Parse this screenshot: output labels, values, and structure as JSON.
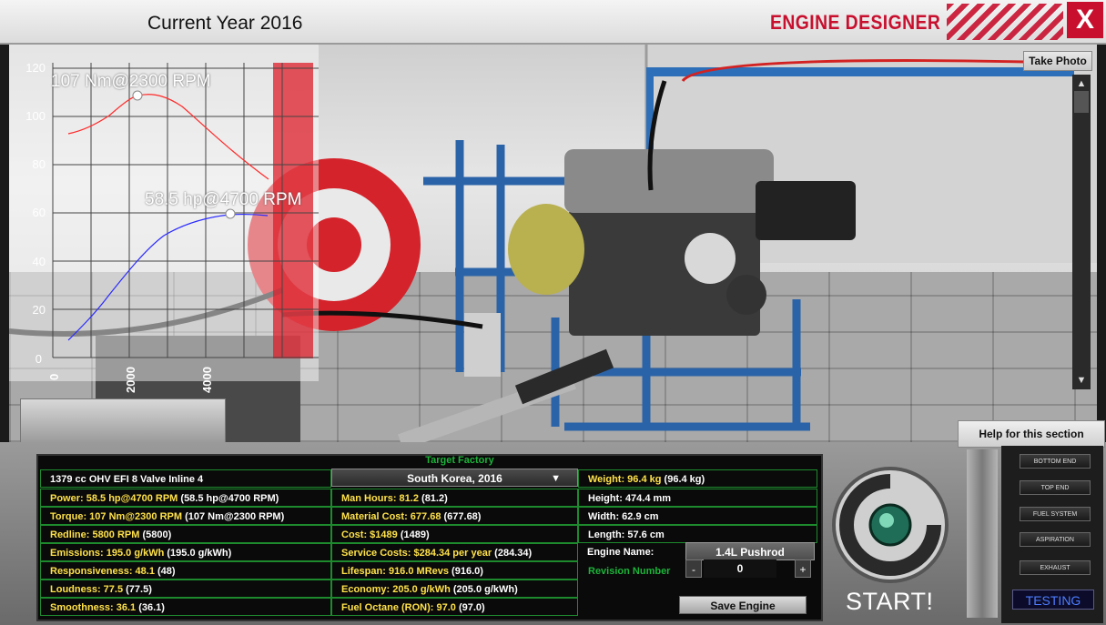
{
  "header": {
    "year": "Current Year 2016",
    "brand": "ENGINE DESIGNER",
    "close": "X"
  },
  "viewport": {
    "take_photo": "Take Photo",
    "help_section": "Help for this section"
  },
  "graph": {
    "y_ticks": [
      "120",
      "100",
      "80",
      "60",
      "40",
      "20",
      "0"
    ],
    "x_ticks": [
      "0",
      "2000",
      "4000"
    ],
    "torque_callout": "107 Nm@2300 RPM",
    "power_callout": "58.5 hp@4700 RPM",
    "colors": {
      "torque": "#ff2a2a",
      "power": "#2a2aff"
    }
  },
  "stats": {
    "target_factory_label": "Target Factory",
    "engine_desc": "1379 cc OHV EFI 8 Valve Inline 4",
    "factory": "South Korea, 2016",
    "col1": [
      "Power: 58.5 hp@4700 RPM",
      "Torque: 107 Nm@2300 RPM",
      "Redline: 5800 RPM",
      "Emissions: 195.0 g/kWh",
      "Responsiveness: 48.1",
      "Loudness: 77.5",
      "Smoothness: 36.1"
    ],
    "col1_extra": [
      " (58.5 hp@4700 RPM)",
      " (107 Nm@2300 RPM)",
      " (5800)",
      " (195.0 g/kWh)",
      " (48)",
      " (77.5)",
      " (36.1)"
    ],
    "col2": [
      "Man Hours: 81.2",
      "Material Cost: 677.68",
      "Cost: $1489",
      "Service Costs: $284.34 per year",
      "Lifespan: 916.0 MRevs",
      "Economy: 205.0 g/kWh",
      "Fuel Octane (RON): 97.0"
    ],
    "col2_extra": [
      " (81.2)",
      " (677.68)",
      " (1489)",
      " (284.34)",
      " (916.0)",
      " (205.0 g/kWh)",
      " (97.0)"
    ],
    "weight": "Weight: 96.4 kg",
    "weight_extra": " (96.4 kg)",
    "height": "Height: 474.4 mm",
    "width": "Width: 62.9 cm",
    "length": "Length: 57.6 cm",
    "engine_name_label": "Engine Name:",
    "engine_name": "1.4L Pushrod",
    "revision_label": "Revision Number",
    "revision_value": "0",
    "minus": "-",
    "plus": "+",
    "save": "Save Engine",
    "caret": "▼"
  },
  "start": {
    "label": "START!"
  },
  "sections": {
    "items": [
      "BOTTOM END",
      "TOP END",
      "FUEL SYSTEM",
      "ASPIRATION",
      "EXHAUST"
    ],
    "testing": "TESTING"
  }
}
